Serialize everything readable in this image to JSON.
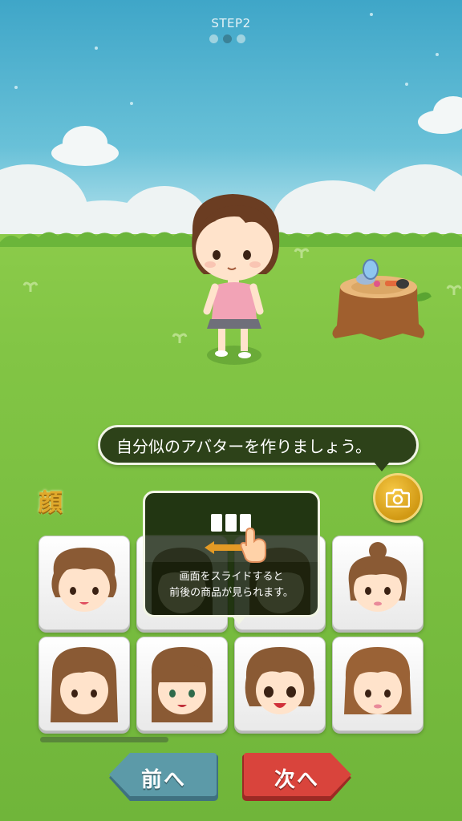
{
  "header": {
    "step_label": "STEP2",
    "steps_total": 3,
    "current_step": 2
  },
  "speech": {
    "text": "自分似のアバターを作りましょう。"
  },
  "category": {
    "label": "顔"
  },
  "camera": {
    "icon": "camera-icon"
  },
  "hint": {
    "line1": "画面をスライドすると",
    "line2": "前後の商品が見られます。"
  },
  "nav": {
    "prev_label": "前へ",
    "next_label": "次へ"
  },
  "colors": {
    "prev": "#5c9aa8",
    "next": "#d9443c",
    "accent": "#e0a92b",
    "bubble": "#2d4219"
  }
}
